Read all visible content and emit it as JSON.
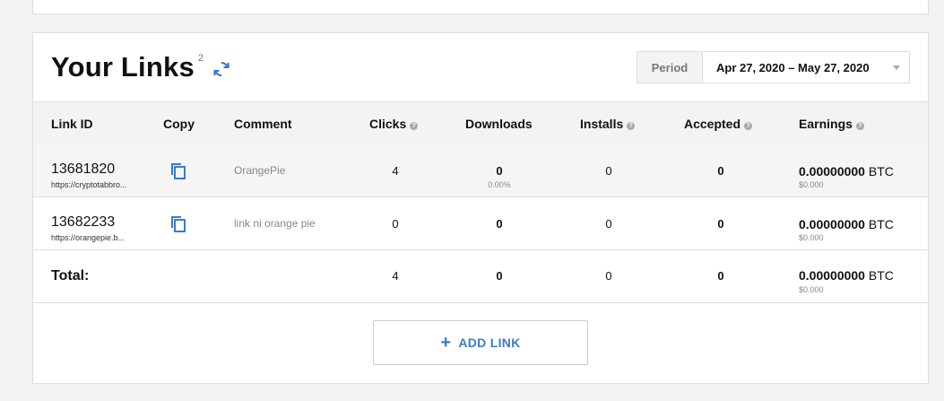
{
  "header": {
    "title": "Your Links",
    "count": "2"
  },
  "period": {
    "label": "Period",
    "value": "Apr 27, 2020 – May 27, 2020"
  },
  "columns": [
    "Link ID",
    "Copy",
    "Comment",
    "Clicks",
    "Downloads",
    "Installs",
    "Accepted",
    "Earnings"
  ],
  "rows": [
    {
      "id": "13681820",
      "url": "https://cryptotabbro...",
      "comment": "OrangePie",
      "clicks": "4",
      "downloads": "0",
      "downloads_pct": "0.00%",
      "installs": "0",
      "accepted": "0",
      "earnings": "0.00000000",
      "currency": "BTC",
      "usd": "$0.000"
    },
    {
      "id": "13682233",
      "url": "https://orangepie.b...",
      "comment": "link ni orange pie",
      "clicks": "0",
      "downloads": "0",
      "downloads_pct": "",
      "installs": "0",
      "accepted": "0",
      "earnings": "0.00000000",
      "currency": "BTC",
      "usd": "$0.000"
    }
  ],
  "total": {
    "label": "Total:",
    "clicks": "4",
    "downloads": "0",
    "installs": "0",
    "accepted": "0",
    "earnings": "0.00000000",
    "currency": "BTC",
    "usd": "$0.000"
  },
  "add_link": {
    "icon": "plus-icon",
    "label": "ADD LINK"
  },
  "colors": {
    "accent": "#3b7bc7",
    "header_bg": "#f3f3f3",
    "border": "#dddddd"
  }
}
